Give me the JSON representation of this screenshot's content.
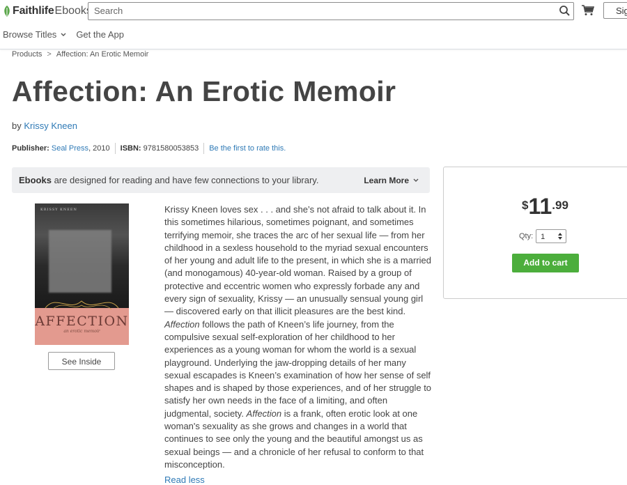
{
  "header": {
    "logo_brand": "Faithlife",
    "logo_product": "Ebooks",
    "search_placeholder": "Search",
    "signin_label": "Sig",
    "nav": [
      {
        "label": "Browse Titles"
      },
      {
        "label": "Get the App"
      }
    ]
  },
  "breadcrumb": {
    "items": [
      "Products",
      "Affection: An Erotic Memoir"
    ],
    "separator": ">"
  },
  "product": {
    "title": "Affection: An Erotic Memoir",
    "by_prefix": "by",
    "author": "Krissy Kneen",
    "publisher_label": "Publisher:",
    "publisher": "Seal Press",
    "year": ", 2010",
    "isbn_label": "ISBN:",
    "isbn": "9781580053853",
    "rate_text": "Be the first to rate this.",
    "cover": {
      "author_text": "KRISSY KNEEN",
      "title_text": "AFFECTION",
      "subtitle_text": "an erotic memoir"
    },
    "see_inside_label": "See Inside"
  },
  "notice": {
    "bold": "Ebooks",
    "text": " are designed for reading and have few connections to your library.",
    "learn_more": "Learn More"
  },
  "description": {
    "text_1": "Krissy Kneen loves sex . . . and she’s not afraid to talk about it. In this sometimes hilarious, sometimes poignant, and sometimes terrifying memoir, she traces the arc of her sexual life — from her childhood in a sexless household to the myriad sexual encounters of her young and adult life to the present, in which she is a married (and monogamous) 40-year-old woman. Raised by a group of protective and eccentric women who expressly forbade any and every sign of sexuality, Krissy — an unusually sensual young girl — discovered early on that illicit pleasures are the best kind. ",
    "italic_1": "Affection",
    "text_2": " follows the path of Kneen’s life journey, from the compulsive sexual self-exploration of her childhood to her experiences as a young woman for whom the world is a sexual playground. Underlying the jaw-dropping details of her many sexual escapades is Kneen’s examination of how her sense of self shapes and is shaped by those experiences, and of her struggle to satisfy her own needs in the face of a limiting, and often judgmental, society. ",
    "italic_2": "Affection",
    "text_3": " is a frank, often erotic look at one woman's sexuality as she grows and changes in a world that continues to see only the young and the beautiful amongst us as sexual beings — and a chronicle of her refusal to conform to that misconception.",
    "read_less": "Read less"
  },
  "purchase": {
    "currency": "$",
    "price_whole": "11",
    "price_cents": ".99",
    "qty_label": "Qty:",
    "qty_value": "1",
    "add_to_cart": "Add to cart"
  },
  "colors": {
    "link": "#2f7ab6",
    "button_green": "#4cae3c",
    "logo_green": "#5aa64a"
  },
  "icons": [
    "leaf-logo-icon",
    "search-icon",
    "cart-icon",
    "chevron-down-icon",
    "stepper-arrows-icon"
  ]
}
